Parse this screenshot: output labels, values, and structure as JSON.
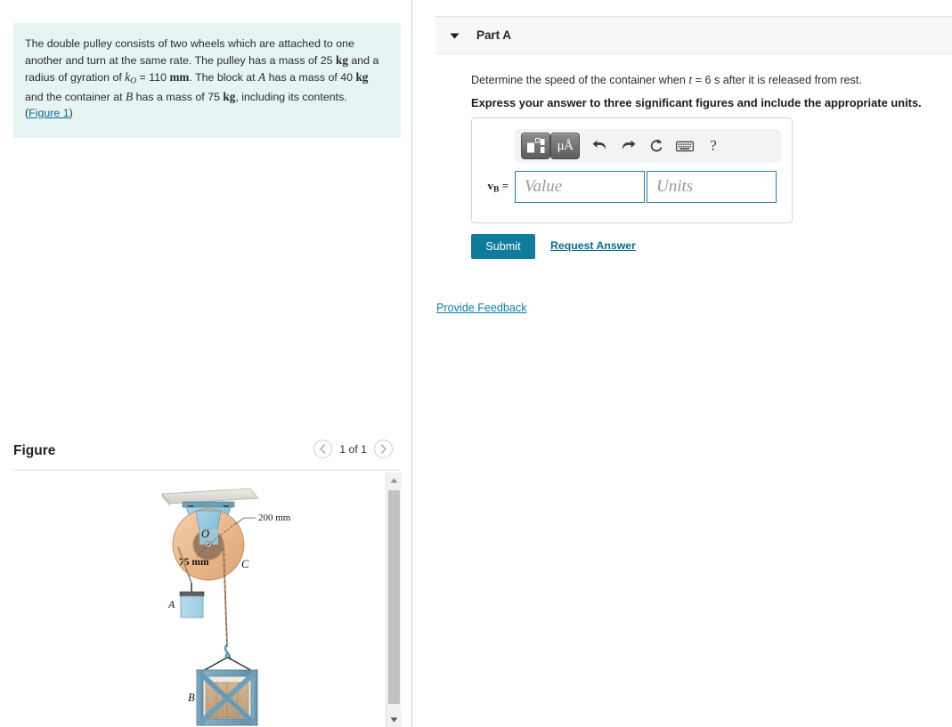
{
  "problem": {
    "text_part1": "The double pulley consists of two wheels which are attached to one another and turn at the same rate. The pulley has a mass of 25 ",
    "unit_kg_1": "kg",
    "text_part2": " and a radius of gyration of ",
    "var_k": "k",
    "var_k_sub": "O",
    "text_part3": " = 110 ",
    "unit_mm": "mm",
    "text_part4": ". The block at ",
    "var_A": "A",
    "text_part5": " has a mass of 40 ",
    "unit_kg_2": "kg",
    "text_part6": " and the container at ",
    "var_B": "B",
    "text_part7": " has a mass of 75 ",
    "unit_kg_3": "kg",
    "text_part8": ", including its contents. (",
    "figure_link": "Figure 1",
    "text_part9": ")"
  },
  "figure": {
    "title": "Figure",
    "pager_label": "1 of 1",
    "prev_icon": "chevron-left-icon",
    "next_icon": "chevron-right-icon",
    "labels": {
      "outer_radius": "200 mm",
      "inner_radius": "75 mm",
      "center": "O",
      "pulley": "C",
      "block": "A",
      "container": "B"
    },
    "colors": {
      "pulley_outer": "#e9b98f",
      "pulley_inner": "#9b7a5e",
      "bracket_blue": "#8cc3da",
      "ceiling_gray": "#dedbd4",
      "block_blue": "#a9d3e6",
      "crate_frame": "#6f9fb8",
      "crate_wood": "#c9a98a",
      "rope": "#b08b63"
    }
  },
  "part": {
    "caret_icon": "caret-down-icon",
    "title": "Part A",
    "question": {
      "prefix": "Determine the speed of the container when ",
      "var_t": "t",
      "equals": " = 6",
      "suffix": "  s after it is released from rest."
    },
    "instruction": "Express your answer to three significant figures and include the appropriate units."
  },
  "answer": {
    "label_var": "v",
    "label_sub": "B",
    "label_eq": " =",
    "value_placeholder": "Value",
    "value_current": "",
    "units_placeholder": "Units",
    "units_current": "",
    "toolbar": [
      {
        "name": "math-template-icon",
        "label": ""
      },
      {
        "name": "units-mu-angstrom-icon",
        "label": "μÅ"
      },
      {
        "name": "undo-icon",
        "label": ""
      },
      {
        "name": "redo-icon",
        "label": ""
      },
      {
        "name": "reset-icon",
        "label": ""
      },
      {
        "name": "keyboard-icon",
        "label": ""
      },
      {
        "name": "help-icon",
        "label": "?"
      }
    ]
  },
  "actions": {
    "submit_label": "Submit",
    "request_answer_label": "Request Answer",
    "provide_feedback_label": "Provide Feedback"
  },
  "colors": {
    "accent_teal": "#0f7c9c",
    "link_blue": "#0b6a8a",
    "problem_bg": "#e6f4f3",
    "input_border": "#2b7b96"
  }
}
